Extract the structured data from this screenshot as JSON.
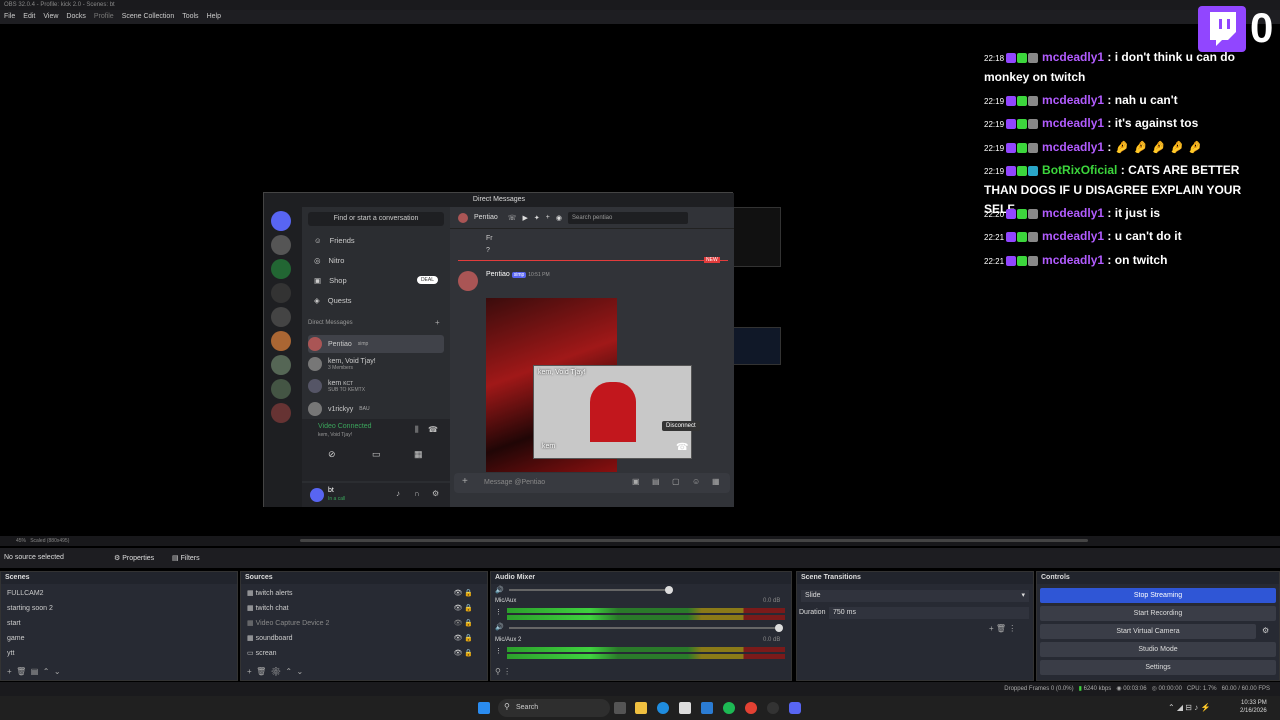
{
  "window": {
    "title": "OBS 32.0.4 - Profile: kick 2.0 - Scenes: bt"
  },
  "menu": [
    "File",
    "Edit",
    "View",
    "Docks",
    "Profile",
    "Scene Collection",
    "Tools",
    "Help"
  ],
  "twitch": {
    "viewer_count": "0"
  },
  "chat": [
    {
      "time": "22:18",
      "user": "mcdeadly1",
      "user_color": "#b25cff",
      "text": ": i don't think u can do monkey on twitch"
    },
    {
      "time": "22:19",
      "user": "mcdeadly1",
      "user_color": "#b25cff",
      "text": ": nah u can't"
    },
    {
      "time": "22:19",
      "user": "mcdeadly1",
      "user_color": "#b25cff",
      "text": ": it's against tos"
    },
    {
      "time": "22:19",
      "user": "mcdeadly1",
      "user_color": "#b25cff",
      "text": ": 🤌 🤌 🤌 🤌 🤌"
    },
    {
      "time": "22:19",
      "user": "BotRixOficial",
      "user_color": "#3cd63c",
      "text": ": CATS ARE BETTER THAN DOGS IF U DISAGREE EXPLAIN YOUR SELF"
    },
    {
      "time": "22:20",
      "user": "mcdeadly1",
      "user_color": "#b25cff",
      "text": ": it just is"
    },
    {
      "time": "22:21",
      "user": "mcdeadly1",
      "user_color": "#b25cff",
      "text": ": u can't do it"
    },
    {
      "time": "22:21",
      "user": "mcdeadly1",
      "user_color": "#b25cff",
      "text": ": on twitch"
    }
  ],
  "discord": {
    "window_title": "Direct Messages",
    "search_placeholder": "Find or start a conversation",
    "nav": [
      "Friends",
      "Nitro",
      "Shop",
      "Quests"
    ],
    "shop_badge": "DEAL",
    "dm_header": "Direct Messages",
    "dms": [
      {
        "name": "Pentiao",
        "tag": "simp"
      },
      {
        "name": "kem, Void Tjay!",
        "sub": "3 Members"
      },
      {
        "name": "kem",
        "tag": "KCT",
        "sub": "SUB TO KEMTX"
      },
      {
        "name": "v1rickyy",
        "tag": "BAU"
      }
    ],
    "voice_status": "Video Connected",
    "voice_sub": "kem, Void Tjay!",
    "user": "bt",
    "user_status": "In a call",
    "chat_user": "Pentiao",
    "chat_search": "Search pentiao",
    "messages_top": [
      "Fr",
      "?"
    ],
    "new_label": "NEW",
    "msg_author": "Pentiao",
    "msg_tag": "simp",
    "msg_time": "10:51 PM",
    "call_title": "kem, Void Tjay!",
    "call_name": "kem",
    "disconnect": "Disconnect",
    "message_placeholder": "Message @Pentiao"
  },
  "obs": {
    "zoom": "45%",
    "scale": "Scaled (880x495)",
    "no_source": "No source selected",
    "properties": "Properties",
    "filters": "Filters",
    "scenes_title": "Scenes",
    "scenes": [
      "FULLCAM2",
      "starting soon 2",
      "start",
      "game",
      "ytt"
    ],
    "sources_title": "Sources",
    "sources": [
      "twitch alerts",
      "twitch chat",
      "Video Capture Device 2",
      "soundboard",
      "screan"
    ],
    "mixer_title": "Audio Mixer",
    "mixer": [
      {
        "name": "Mic/Aux",
        "db": "0.0 dB"
      },
      {
        "name": "Mic/Aux 2",
        "db": "0.0 dB"
      }
    ],
    "transitions_title": "Scene Transitions",
    "transition": "Slide",
    "duration_label": "Duration",
    "duration": "750 ms",
    "controls_title": "Controls",
    "controls": [
      "Stop Streaming",
      "Start Recording",
      "Start Virtual Camera",
      "Studio Mode",
      "Settings"
    ],
    "status": {
      "dropped": "Dropped Frames 0 (0.0%)",
      "kbps": "6240 kbps",
      "stream_time": "00:03:06",
      "rec_time": "00:00:00",
      "cpu": "CPU: 1.7%",
      "fps": "60.00 / 60.00 FPS"
    }
  },
  "taskbar": {
    "search": "Search",
    "time": "10:33 PM",
    "date": "2/16/2026"
  },
  "colors": {
    "accent": "#2f56d6",
    "twitch": "#9146ff",
    "discord_blurple": "#5865f2"
  }
}
